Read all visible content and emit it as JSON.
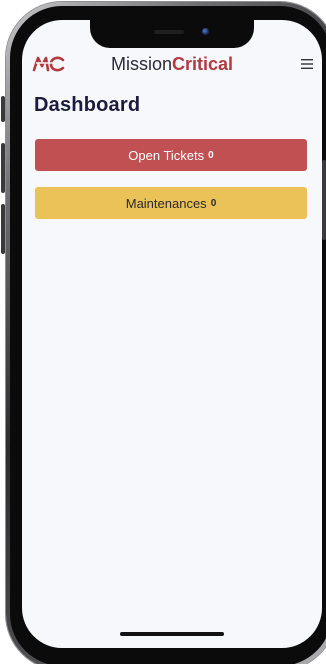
{
  "app": {
    "brand_part1": "Mission",
    "brand_part2": "Critical",
    "logo_text": "MC",
    "menu_icon": "hamburger-menu-icon"
  },
  "page": {
    "title": "Dashboard"
  },
  "tiles": [
    {
      "label": "Open Tickets",
      "count": "0",
      "color": "#c05052"
    },
    {
      "label": "Maintenances",
      "count": "0",
      "color": "#eac257"
    }
  ],
  "colors": {
    "brand_red": "#b23a3e",
    "title_navy": "#1c1d3d",
    "screen_bg": "#f7f8fb"
  }
}
